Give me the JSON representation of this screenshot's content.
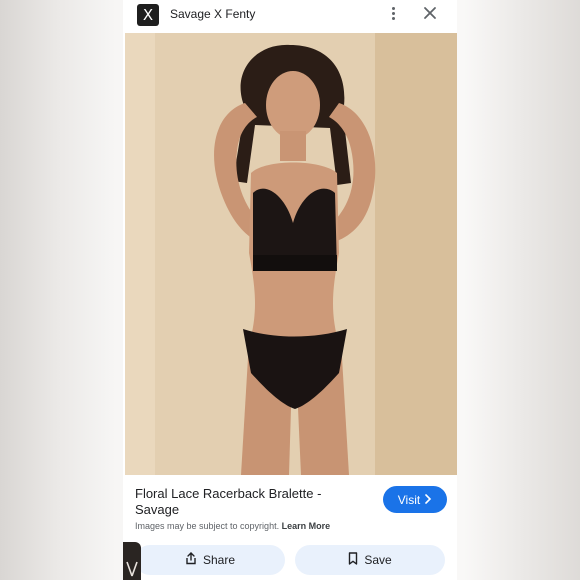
{
  "header": {
    "logo_glyph": "X",
    "site_name": "Savage X Fenty",
    "more_icon": "more-vert-icon",
    "close_icon": "close-icon"
  },
  "result": {
    "title": "Floral Lace Racerback Bralette - Savage",
    "visit_label": "Visit",
    "disclaimer": "Images may be subject to copyright.",
    "learn_more": "Learn More",
    "share_label": "Share",
    "save_label": "Save"
  },
  "colors": {
    "accent": "#1a73e8",
    "pill_background": "#e9f1fc"
  }
}
